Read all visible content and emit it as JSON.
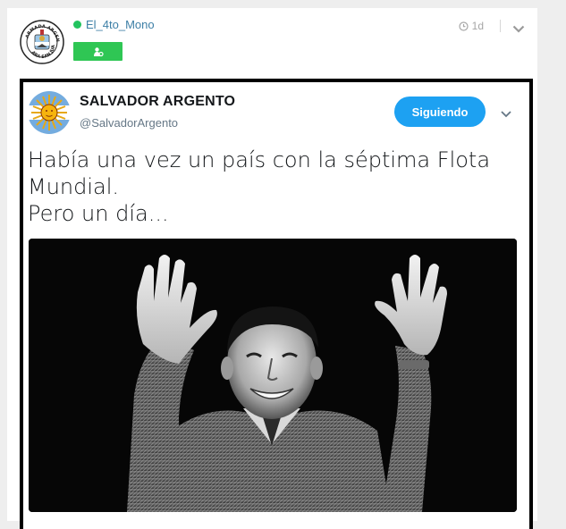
{
  "post": {
    "username": "El_4to_Mono",
    "time": "1d",
    "avatar_icon": "navy-crest-icon",
    "avatar_crest_text": "ARMADA ARGENTINA · ARA SAN JUAN",
    "badge_icon": "user-badge-icon",
    "status_color": "#22c35e",
    "badge_color": "#2fc654",
    "username_color": "#3d7fa6"
  },
  "tweet": {
    "name": "SALVADOR ARGENTO",
    "handle": "@SalvadorArgento",
    "follow_label": "Siguiendo",
    "follow_color": "#1da1f2",
    "text": "Había una vez un país con la séptima Flota\nMundial.\n Pero un día...",
    "avatar_icon": "sun-of-may-icon",
    "photo_icon": "black-and-white-photo-man-raising-hands"
  }
}
